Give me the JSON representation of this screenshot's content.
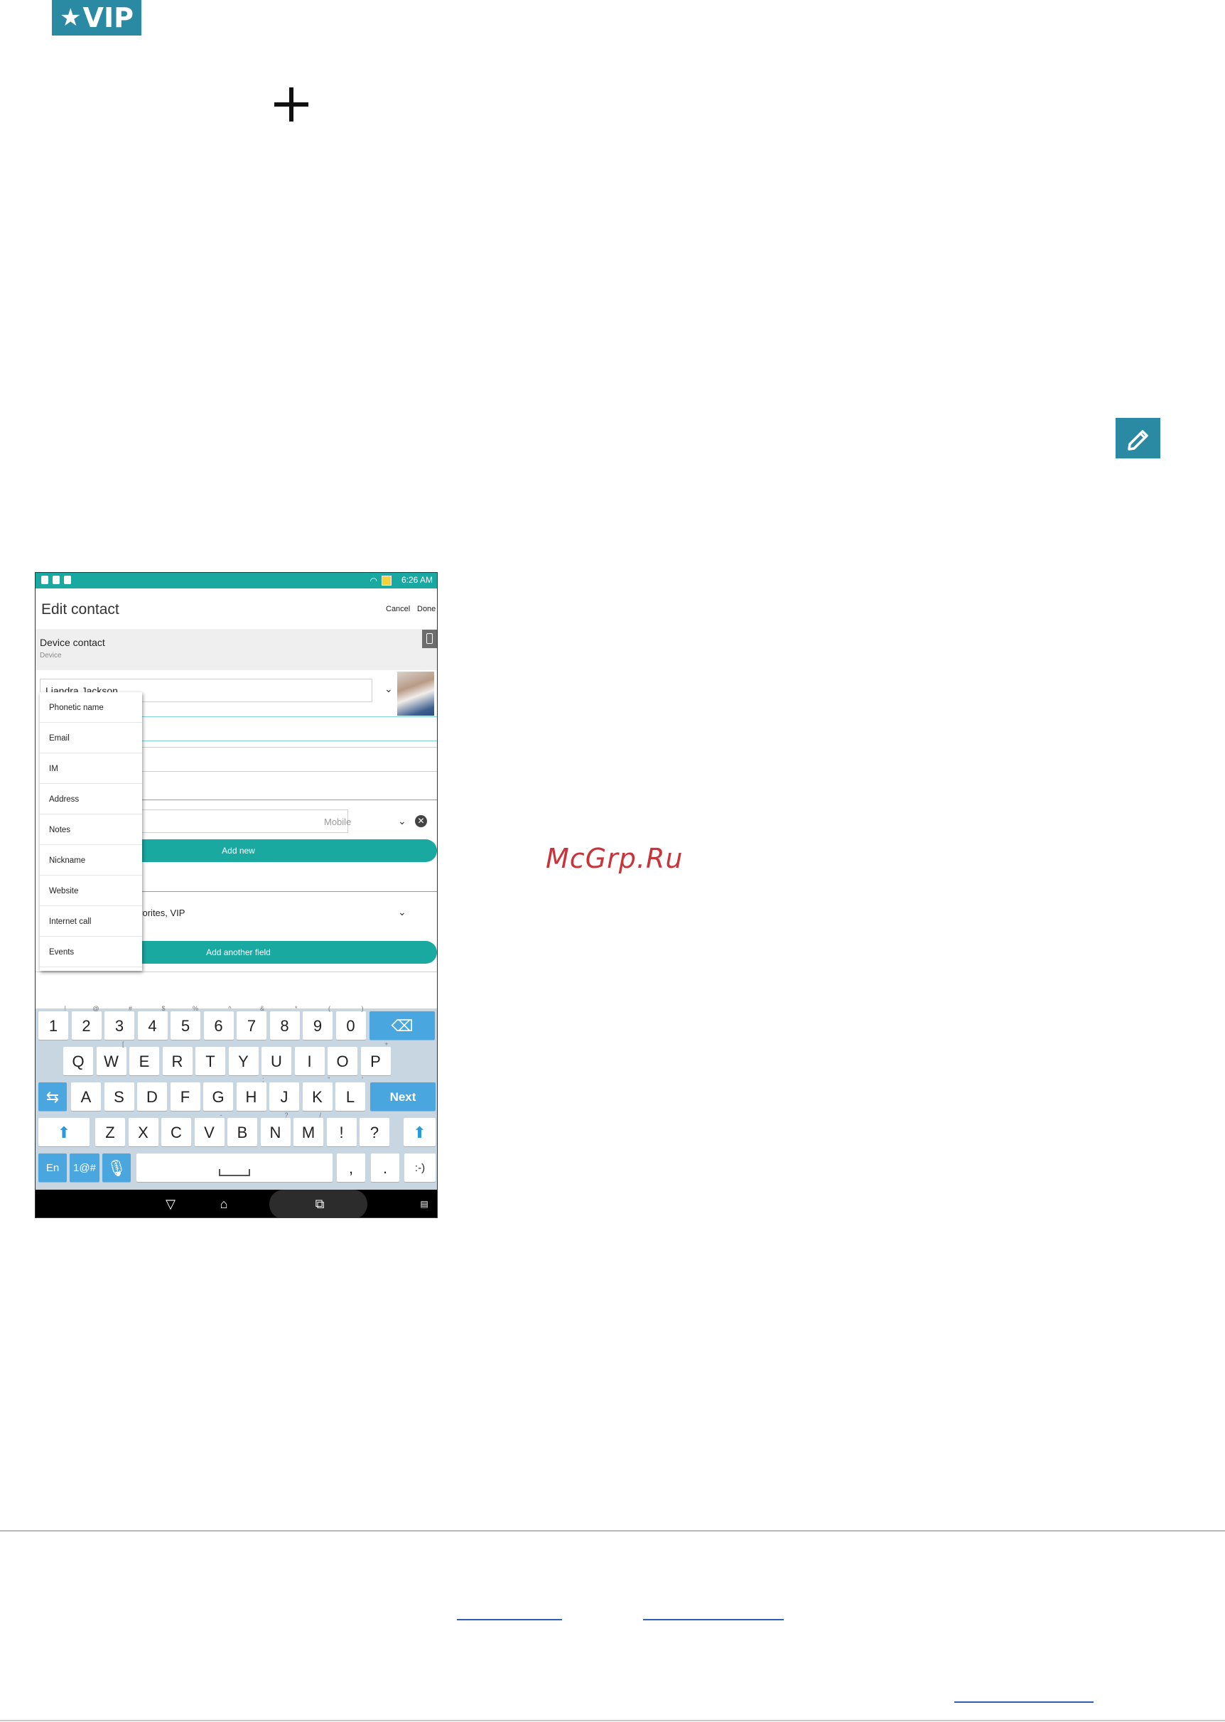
{
  "badge": {
    "star": "★",
    "label": "VIP",
    "color": "#2b8aa3"
  },
  "icons": {
    "plus": "plus-icon",
    "edit": "pencil-icon"
  },
  "watermark": "McGrp.Ru",
  "phone": {
    "status_time": "6:26 AM",
    "title": "Edit contact",
    "cancel": "Cancel",
    "done": "Done",
    "account_name": "Device contact",
    "account_type": "Device",
    "name_value": "Liandra Jackson",
    "phone_type": "Mobile",
    "add_new": "Add new",
    "groups_value": "vorites, VIP",
    "add_another_field": "Add another field",
    "menu_items": [
      "Phonetic name",
      "Email",
      "IM",
      "Address",
      "Notes",
      "Nickname",
      "Website",
      "Internet call",
      "Events"
    ],
    "accent_color": "#1aa9a1"
  },
  "keyboard": {
    "row1": [
      [
        "1",
        "!"
      ],
      [
        "2",
        "@"
      ],
      [
        "3",
        "#"
      ],
      [
        "4",
        "$"
      ],
      [
        "5",
        "%"
      ],
      [
        "6",
        "^"
      ],
      [
        "7",
        "&"
      ],
      [
        "8",
        "*"
      ],
      [
        "9",
        "("
      ],
      [
        "0",
        ")"
      ]
    ],
    "row2": [
      [
        "Q",
        ""
      ],
      [
        "W",
        "["
      ],
      [
        "E",
        ""
      ],
      [
        "R",
        ""
      ],
      [
        "T",
        ""
      ],
      [
        "Y",
        ""
      ],
      [
        "U",
        ""
      ],
      [
        "I",
        ""
      ],
      [
        "O",
        ""
      ],
      [
        "P",
        "+"
      ]
    ],
    "row3": [
      [
        "A",
        ""
      ],
      [
        "S",
        ""
      ],
      [
        "D",
        ""
      ],
      [
        "F",
        ""
      ],
      [
        "G",
        ""
      ],
      [
        "H",
        ";"
      ],
      [
        "J",
        ""
      ],
      [
        "K",
        "\""
      ],
      [
        "L",
        "'"
      ]
    ],
    "row4": [
      [
        "Z",
        ""
      ],
      [
        "X",
        ""
      ],
      [
        "C",
        ""
      ],
      [
        "V",
        "-"
      ],
      [
        "B",
        ""
      ],
      [
        "N",
        "?"
      ],
      [
        "M",
        "/"
      ],
      [
        "!",
        ""
      ],
      [
        "?",
        ""
      ]
    ],
    "next": "Next",
    "lang": "En",
    "symbols": "1@#",
    "comma": ",",
    "period": ".",
    "smiley": ":-)"
  }
}
